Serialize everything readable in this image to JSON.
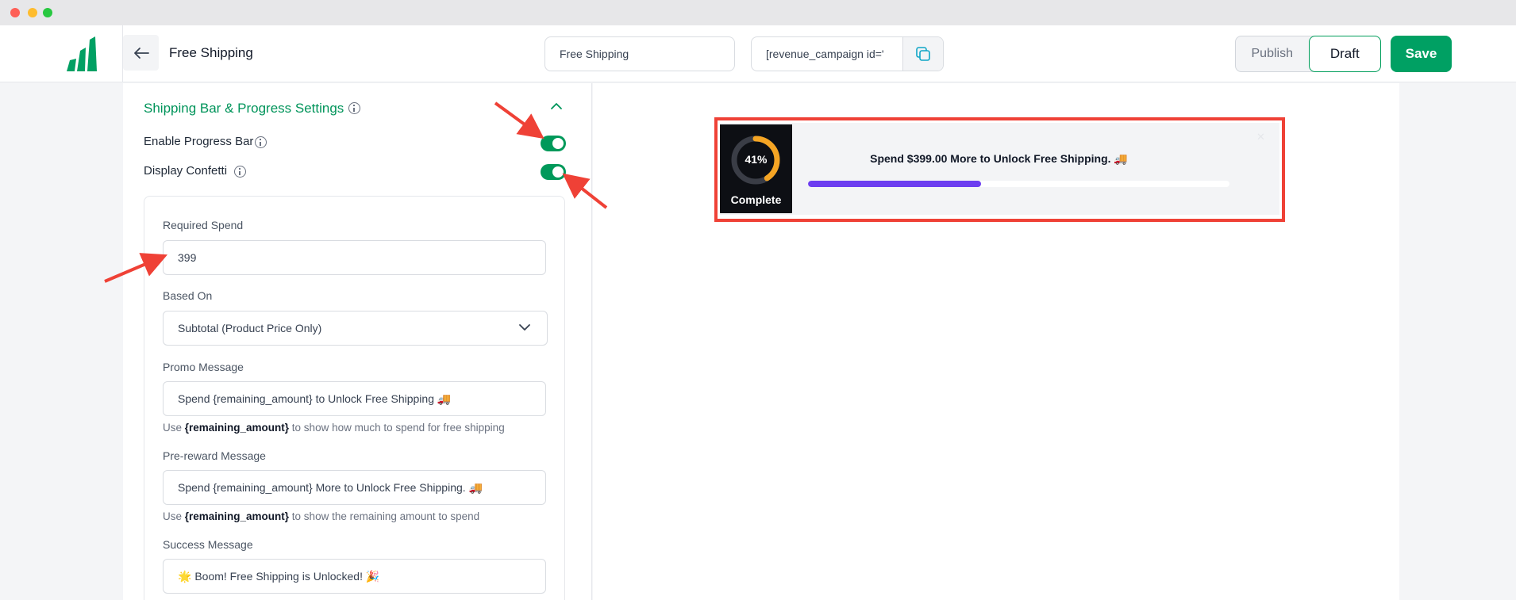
{
  "header": {
    "page_title": "Free Shipping",
    "campaign_name_value": "Free Shipping",
    "shortcode_value": "[revenue_campaign id='",
    "publish_label": "Publish",
    "draft_label": "Draft",
    "save_label": "Save"
  },
  "settings": {
    "section_title": "Shipping Bar & Progress Settings",
    "enable_progress_bar_label": "Enable Progress Bar",
    "enable_progress_bar_on": true,
    "display_confetti_label": "Display Confetti",
    "display_confetti_on": true,
    "required_spend_label": "Required Spend",
    "required_spend_value": "399",
    "based_on_label": "Based On",
    "based_on_value": "Subtotal (Product Price Only)",
    "promo_message_label": "Promo Message",
    "promo_message_value": "Spend {remaining_amount} to Unlock Free Shipping 🚚",
    "promo_helper_prefix": "Use ",
    "promo_helper_token": "{remaining_amount}",
    "promo_helper_suffix": " to show how much to spend for free shipping",
    "pre_reward_label": "Pre-reward Message",
    "pre_reward_value": "Spend {remaining_amount} More to Unlock Free Shipping. 🚚",
    "pre_reward_helper_prefix": "Use ",
    "pre_reward_helper_token": "{remaining_amount}",
    "pre_reward_helper_suffix": " to show the remaining amount to spend",
    "success_label": "Success Message",
    "success_value": "🌟 Boom! Free Shipping is Unlocked! 🎉"
  },
  "preview": {
    "percent_label": "41%",
    "progress_fraction": 0.41,
    "complete_label": "Complete",
    "message": "Spend $399.00 More to Unlock Free Shipping. 🚚"
  },
  "colors": {
    "brand_green": "#00a063",
    "progress_fill": "#6c3df0",
    "ring_accent": "#f5a524",
    "annotation_red": "#ef4136"
  },
  "icons": {
    "logo": "revenue-logo-icon",
    "back": "arrow-left-icon",
    "copy": "copy-icon",
    "info": "info-icon",
    "collapse": "chevron-up-icon",
    "select": "chevron-down-icon"
  }
}
